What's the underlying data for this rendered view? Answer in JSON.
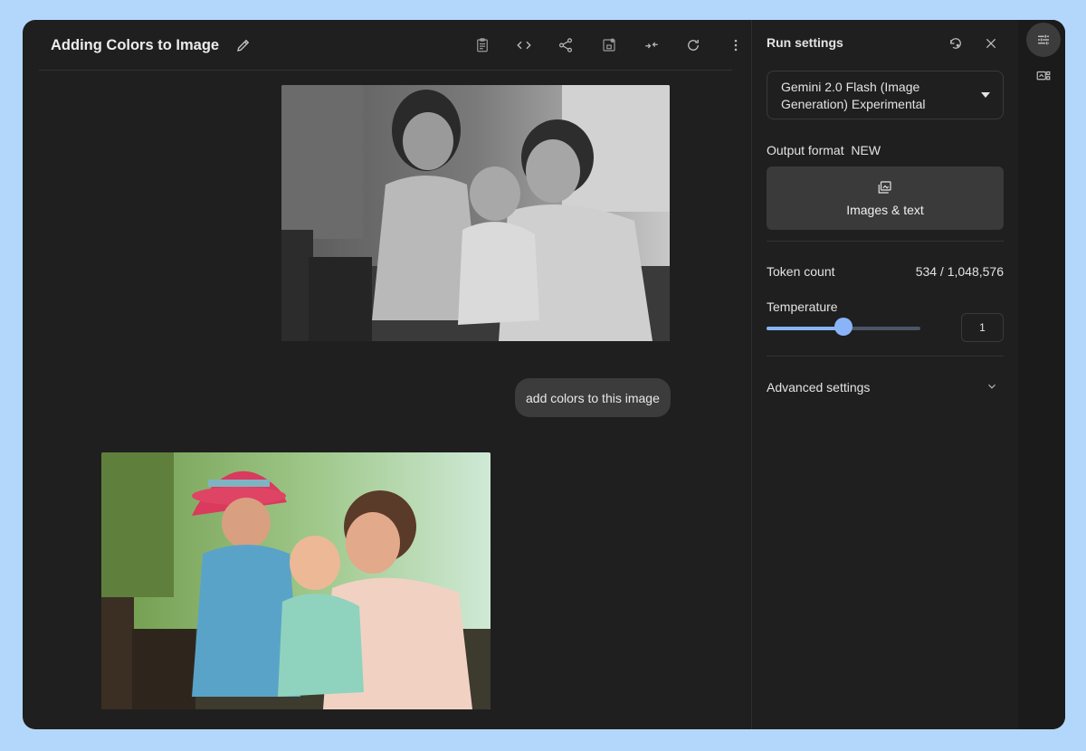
{
  "header": {
    "title": "Adding Colors to Image"
  },
  "toolbar": {
    "icons": [
      "clipboard-icon",
      "code-icon",
      "share-icon",
      "save-icon",
      "compare-icon",
      "refresh-icon",
      "more-vert-icon"
    ]
  },
  "chat": {
    "user_message": "add colors to this image"
  },
  "run_settings": {
    "title": "Run settings",
    "model": "Gemini 2.0 Flash (Image Generation) Experimental",
    "output_format_label": "Output format",
    "output_format_badge": "NEW",
    "output_format_value": "Images & text",
    "token_count_label": "Token count",
    "token_count_value": "534 / 1,048,576",
    "temperature_label": "Temperature",
    "temperature_value": "1",
    "temperature_fraction": 0.5,
    "advanced_label": "Advanced settings"
  },
  "colors": {
    "accent": "#8ab4f8",
    "surface": "#1f1f1f",
    "page_bg": "#b3d7fb"
  }
}
